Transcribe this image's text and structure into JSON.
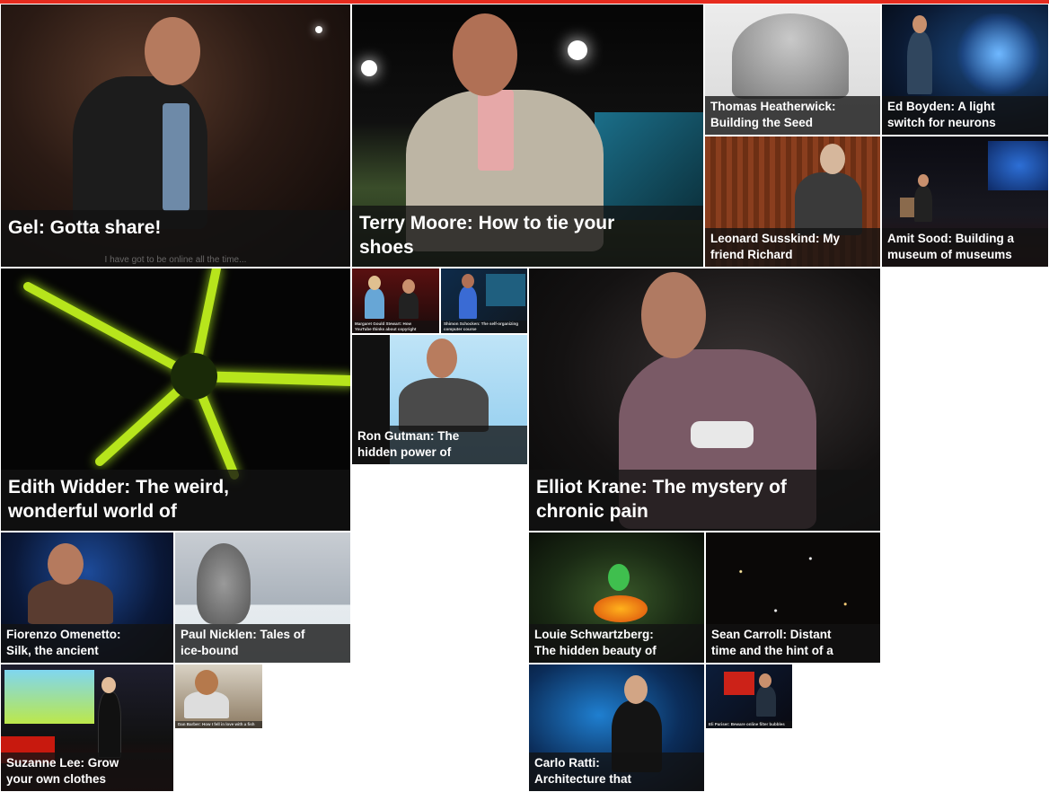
{
  "colors": {
    "accent": "#e62b1e",
    "caption_bg": "rgba(18,18,18,0.78)",
    "caption_text": "#ffffff"
  },
  "tiles": {
    "gel": {
      "title": "Gel: Gotta share!",
      "subtitle": "I have got to be online all the time..."
    },
    "terry": {
      "title": "Terry Moore: How to tie your\nshoes"
    },
    "thomas": {
      "title": "Thomas Heatherwick:\nBuilding the Seed"
    },
    "ed": {
      "title": "Ed Boyden: A light\nswitch for neurons"
    },
    "leonard": {
      "title": "Leonard Susskind: My\nfriend Richard"
    },
    "amit": {
      "title": "Amit Sood: Building a\nmuseum of museums"
    },
    "edith": {
      "title": "Edith Widder: The weird,\nwonderful world of"
    },
    "small1": {
      "title": "Margaret Gould Stewart: How\nYouTube thinks about copyright"
    },
    "small2": {
      "title": "Shimon Schocken: The self-organizing computer course"
    },
    "ron": {
      "title": "Ron Gutman: The\nhidden power of"
    },
    "elliot": {
      "title": "Elliot Krane: The mystery of\nchronic pain"
    },
    "fiorenzo": {
      "title": "Fiorenzo Omenetto:\nSilk, the ancient"
    },
    "paul": {
      "title": "Paul Nicklen: Tales of\nice-bound"
    },
    "louie": {
      "title": "Louie Schwartzberg:\nThe hidden beauty of"
    },
    "sean": {
      "title": "Sean Carroll: Distant\ntime and the hint of a"
    },
    "suzanne": {
      "title": "Suzanne Lee: Grow\nyour own clothes"
    },
    "small3": {
      "title": "Dan Barber: How I fell in love with a fish"
    },
    "carlo": {
      "title": "Carlo Ratti:\nArchitecture that"
    },
    "small4": {
      "title": "Eli Pariser: Beware online filter bubbles"
    }
  }
}
